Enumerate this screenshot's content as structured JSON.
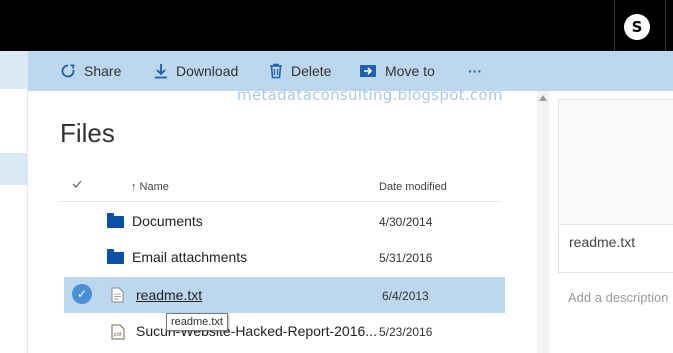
{
  "cmdbar": {
    "share": "Share",
    "download": "Download",
    "delete": "Delete",
    "move_to": "Move to",
    "more": "···"
  },
  "watermark": "metadataconsulting.blogspot.com",
  "main": {
    "title": "Files",
    "columns": {
      "name": "↑ Name",
      "date": "Date modified"
    },
    "rows": [
      {
        "name": "Documents",
        "date": "4/30/2014",
        "type": "folder-icon"
      },
      {
        "name": "Email attachments",
        "date": "5/31/2016",
        "type": "folder-icon"
      },
      {
        "name": "readme.txt",
        "date": "6/4/2013",
        "type": "text-file-icon"
      },
      {
        "name": "Sucuri-Website-Hacked-Report-2016...",
        "date": "5/23/2016",
        "type": "pdf-file-icon"
      }
    ],
    "tooltip": "readme.txt"
  },
  "details": {
    "name": "readme.txt",
    "description_placeholder": "Add a description"
  },
  "colors": {
    "topbar": "#000000",
    "cmdbar": "#bcd7ee",
    "selected_row": "#bcd7ee",
    "folder": "#0a4fa8",
    "check": "#4a90d9"
  }
}
